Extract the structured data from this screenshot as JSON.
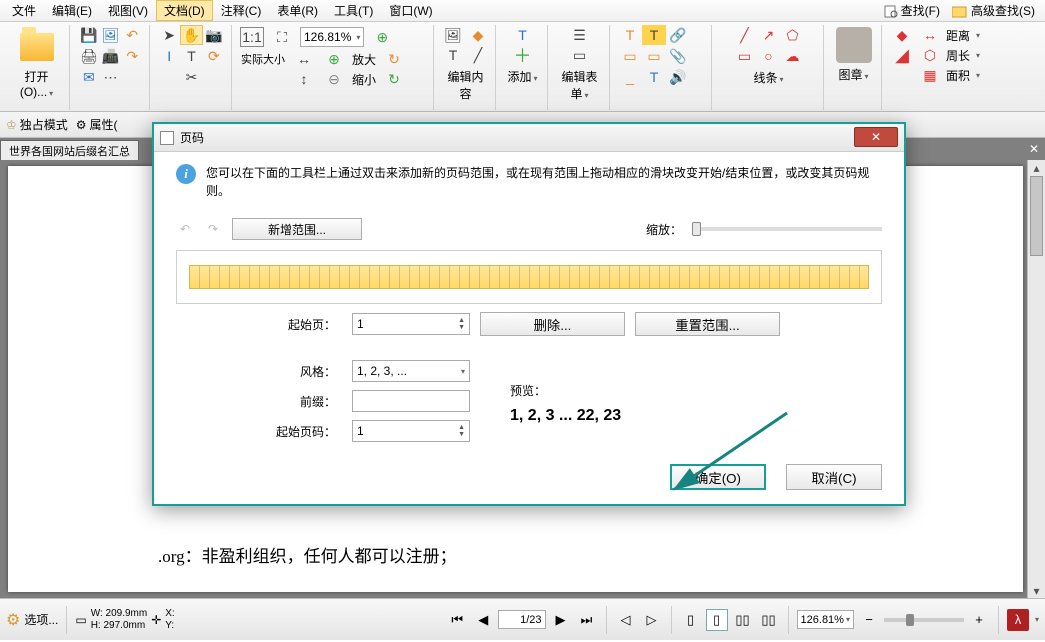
{
  "menu": {
    "file": "文件",
    "edit": "编辑(E)",
    "view": "视图(V)",
    "doc": "文档(D)",
    "annot": "注释(C)",
    "form": "表单(R)",
    "tool": "工具(T)",
    "window": "窗口(W)",
    "find": "查找(F)",
    "adv_find": "高级查找(S)"
  },
  "ribbon": {
    "open": "打开(O)...",
    "actual_size": "实际大小",
    "zoom_in": "放大",
    "zoom_out": "缩小",
    "zoom_value": "126.81%",
    "edit_content": "编辑内容",
    "add": "添加",
    "edit_form": "编辑表单",
    "lines": "线条",
    "stamp": "图章",
    "distance": "距离",
    "perimeter": "周长",
    "area": "面积"
  },
  "toolbar2": {
    "exclusive": "独占模式",
    "properties_trunc": "属性("
  },
  "tab": {
    "title": "世界各国网站后缀名汇总"
  },
  "document": {
    "line": ".org：非盈利组织，任何人都可以注册；"
  },
  "dialog": {
    "title": "页码",
    "info": "您可以在下面的工具栏上通过双击来添加新的页码范围，或在现有范围上拖动相应的滑块改变开始/结束位置，或改变其页码规则。",
    "add_range": "新增范围...",
    "zoom_label": "缩放：",
    "start_page_label": "起始页：",
    "start_page_value": "1",
    "delete_btn": "删除...",
    "reset_btn": "重置范围...",
    "style_label": "风格：",
    "style_value": "1, 2, 3, ...",
    "prefix_label": "前缀：",
    "prefix_value": "",
    "start_num_label": "起始页码：",
    "start_num_value": "1",
    "preview_label": "预览：",
    "preview_value": "1, 2, 3 ... 22, 23",
    "ok": "确定(O)",
    "cancel": "取消(C)"
  },
  "status": {
    "options": "选项...",
    "w": "W: 209.9mm",
    "h": "H: 297.0mm",
    "x": "X:",
    "y": "Y:",
    "page_cur": "1",
    "page_sep": "/",
    "page_total": "23",
    "zoom": "126.81%"
  }
}
